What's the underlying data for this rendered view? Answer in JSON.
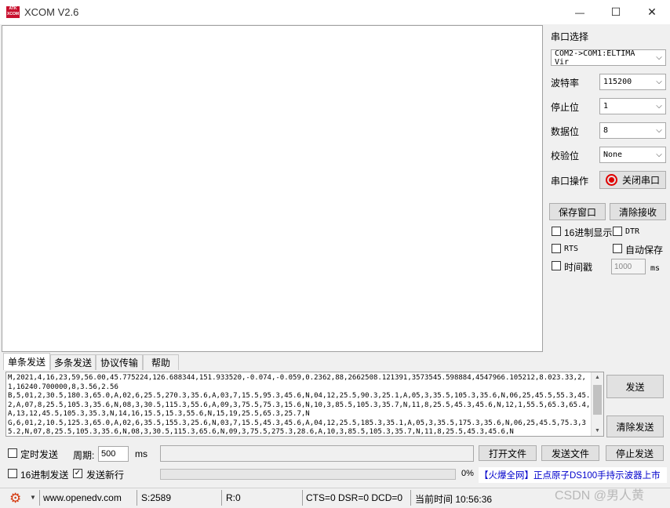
{
  "window": {
    "title": "XCOM V2.6",
    "logo_top": "ATK",
    "logo_bottom": "XCOM",
    "minimize": "—",
    "maximize": "☐",
    "close": "✕"
  },
  "settings": {
    "port_section": "串口选择",
    "port_value": "COM2->COM1:ELTIMA Vir",
    "baud_label": "波特率",
    "baud_value": "115200",
    "stop_label": "停止位",
    "stop_value": "1",
    "data_label": "数据位",
    "data_value": "8",
    "parity_label": "校验位",
    "parity_value": "None",
    "op_label": "串口操作",
    "op_button": "关闭串口",
    "save_window": "保存窗口",
    "clear_receive": "清除接收",
    "hex_display": "16进制显示",
    "dtr": "DTR",
    "rts": "RTS",
    "auto_save": "自动保存",
    "timestamp": "时间戳",
    "timestamp_value": "1000",
    "timestamp_unit": "ms"
  },
  "tabs": [
    "单条发送",
    "多条发送",
    "协议传输",
    "帮助"
  ],
  "send": {
    "text": "M,2021,4,16,23,59,56.00,45.775224,126.688344,151.933520,-0.074,-0.059,0.2362,88,2662508.121391,3573545.598884,4547966.105212,8.023.33,2,1,16240.700000,8,3.56,2.56\nB,5,01,2,30.5,180.3,65.0,A,02,6,25.5,270.3,35.6,A,03,7,15.5,95.3,45.6,N,04,12,25.5,90.3,25.1,A,05,3,35.5,105.3,35.6,N,06,25,45.5,55.3,45.2,A,07,8,25.5,105.3,35.6,N,08,3,30.5,115.3,55.6,A,09,3,75.5,75.3,15.6,N,10,3,85.5,105.3,35.7,N,11,8,25.5,45.3,45.6,N,12,1,55.5,65.3,65.4,A,13,12,45.5,105.3,35.3,N,14,16,15.5,15.3,55.6,N,15,19,25.5,65.3,25.7,N\nG,6,01,2,10.5,125.3,65.0,A,02,6,35.5,155.3,25.6,N,03,7,15.5,45.3,45.6,A,04,12,25.5,185.3,35.1,A,05,3,35.5,175.3,35.6,N,06,25,45.5,75.3,35.2,N,07,8,25.5,105.3,35.6,N,08,3,30.5,115.3,65.6,N,09,3,75.5,275.3,28.6,A,10,3,85.5,105.3,35.7,N,11,8,25.5,45.3,45.6,N",
    "send_button": "发送",
    "clear_send": "清除发送",
    "timed_send": "定时发送",
    "period_label": "周期:",
    "period_value": "500",
    "period_unit": "ms",
    "open_file": "打开文件",
    "send_file": "发送文件",
    "stop_send": "停止发送",
    "hex_send": "16进制发送",
    "send_newline": "发送新行",
    "progress_text": "0%",
    "progress": 0,
    "ad_text": "【火爆全网】正点原子DS100手持示波器上市"
  },
  "status": {
    "website": "www.openedv.com",
    "sent": "S:2589",
    "received": "R:0",
    "lines": "CTS=0 DSR=0 DCD=0",
    "time": "当前时间 10:56:36",
    "watermark": "CSDN @男人黄"
  },
  "colors": {
    "accent_red": "#c8102e",
    "ad_blue": "#0000cc"
  }
}
